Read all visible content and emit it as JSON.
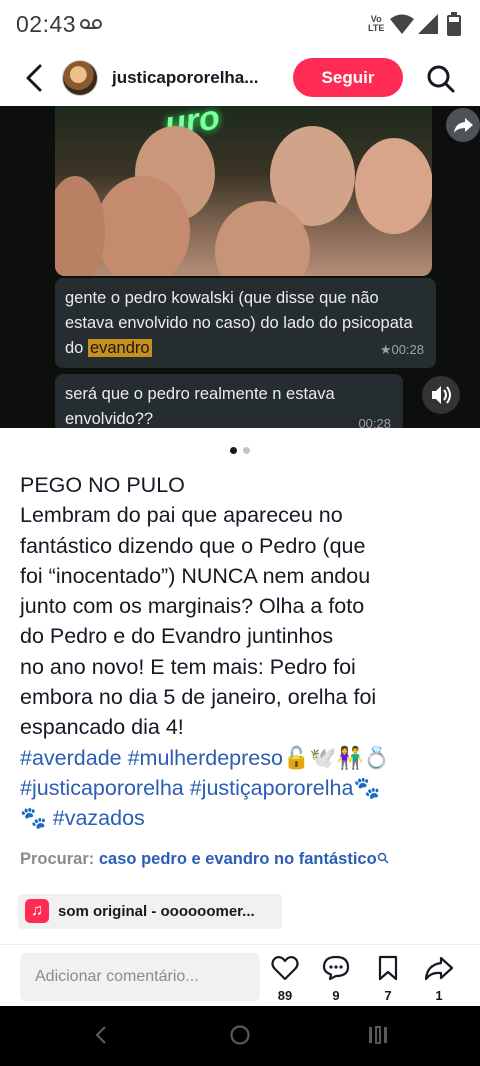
{
  "status_bar": {
    "time": "02:43",
    "network_badge_top": "Vo",
    "network_badge_bottom": "LTE"
  },
  "header": {
    "username": "justicapororelha...",
    "follow_label": "Seguir"
  },
  "media": {
    "neon_text": "uro",
    "message1_text": "gente o pedro kowalski (que disse que não estava envolvido no caso) do lado do psicopata do ",
    "message1_highlight": "evandro",
    "message1_time": "★00:28",
    "message2_text": "será que o pedro realmente n estava envolvido??",
    "message2_time": "00:28",
    "page_count": 2,
    "active_page": 1
  },
  "caption": {
    "lines": [
      "PEGO NO PULO",
      "Lembram do pai que apareceu no",
      "fantástico dizendo que o Pedro (que",
      "foi “inocentado”) NUNCA nem andou",
      "junto com os marginais? Olha a foto",
      "do Pedro e do Evandro juntinhos",
      "no ano novo! E tem mais: Pedro foi",
      "embora no dia 5 de janeiro, orelha foi",
      "espancado dia 4!"
    ],
    "tag_lines": [
      "#averdade #mulherdepreso🔓🕊️👫💍",
      "#justicapororelha #justiçapororelha🐾",
      "🐾 #vazados"
    ]
  },
  "search": {
    "label": "Procurar:",
    "query": "caso pedro e evandro no fantástico"
  },
  "music": {
    "title": "som original - oooooomer..."
  },
  "bottom": {
    "comment_placeholder": "Adicionar comentário...",
    "likes": "89",
    "comments": "9",
    "saves": "7",
    "shares": "1"
  },
  "colors": {
    "accent": "#fe2c55",
    "hashtag": "#2b5db5",
    "highlight": "#c98f1e"
  },
  "icons": [
    "back-arrow-icon",
    "search-icon",
    "share-icon",
    "speaker-icon",
    "heart-icon",
    "comment-icon",
    "bookmark-icon",
    "share-arrow-icon",
    "music-note-icon",
    "nav-back-icon",
    "nav-home-icon",
    "nav-recents-icon"
  ]
}
